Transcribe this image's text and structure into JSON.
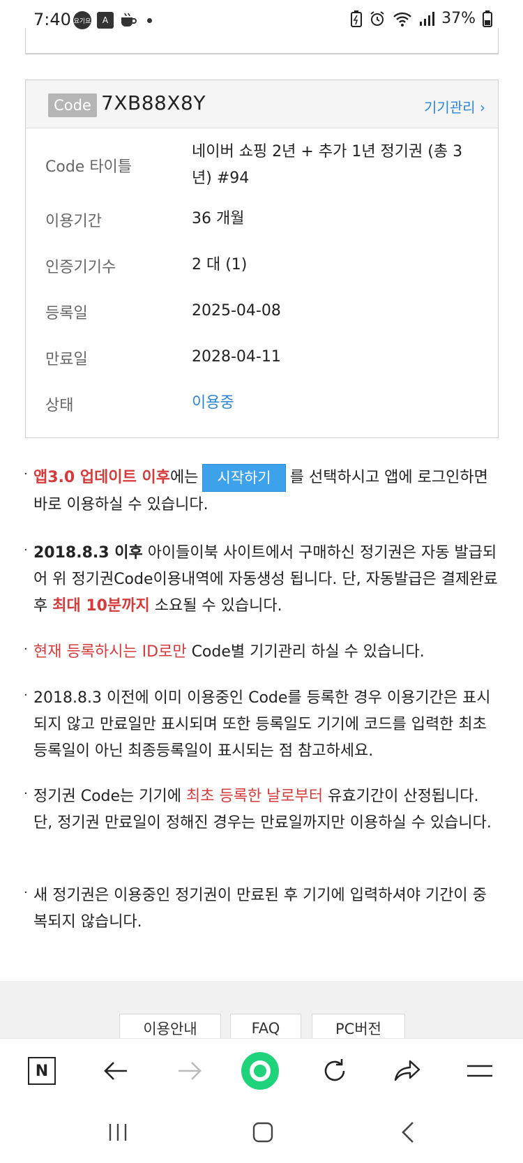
{
  "status_bar": {
    "time": "7:40",
    "badge_text": "요기요",
    "translate_icon_text": "A",
    "battery_percent": "37%"
  },
  "code_card": {
    "tag": "Code",
    "code": "7XB88X8Y",
    "device_link": "기기관리 ›",
    "rows": [
      {
        "label": "Code 타이틀",
        "value": "네이버 쇼핑 2년 + 추가 1년 정기권 (총 3년) #94"
      },
      {
        "label": "이용기간",
        "value": "36 개월"
      },
      {
        "label": "인증기기수",
        "value": "2 대 (1)"
      },
      {
        "label": "등록일",
        "value": "2025-04-08"
      },
      {
        "label": "만료일",
        "value": "2028-04-11"
      },
      {
        "label": "상태",
        "value": "이용중"
      }
    ],
    "status_color": "#2b86d6"
  },
  "notes": {
    "n1": {
      "bullet": "·",
      "red": "앱3.0 업데이트 이후",
      "mid": "에는",
      "button": "시작하기",
      "rest": "를 선택하시고 앱에 로그인하면 바로 이용하실 수 있습니다."
    },
    "n2": {
      "bullet": "·",
      "bold": "2018.8.3 이후",
      "mid": " 아이들이북 사이트에서 구매하신 정기권은 자동 발급되어 위 정기권Code이용내역에 자동생성 됩니다. 단, 자동발급은 결제완료후 ",
      "red": "최대 10분까지",
      "rest": " 소요될 수 있습니다."
    },
    "n3": {
      "bullet": "·",
      "red": "현재 등록하시는 ID로만",
      "rest": " Code별 기기관리 하실 수 있습니다."
    },
    "n4": {
      "bullet": "·",
      "text": "2018.8.3 이전에 이미 이용중인 Code를 등록한 경우 이용기간은 표시되지 않고 만료일만 표시되며 또한 등록일도 기기에 코드를 입력한 최초등록일이 아닌 최종등록일이 표시되는 점 참고하세요."
    },
    "n5": {
      "bullet": "·",
      "pre": "정기권 Code는 기기에 ",
      "red": "최초 등록한 날로부터",
      "rest": " 유효기간이 산정됩니다. 단, 정기권 만료일이 정해진 경우는 만료일까지만 이용하실 수 있습니다."
    },
    "n6": {
      "bullet": "·",
      "text": "새 정기권은 이용중인 정기권이 만료된 후 기기에 입력하셔야 기간이 중복되지 않습니다."
    }
  },
  "footer": {
    "buttons": [
      "이용안내",
      "FAQ",
      "PC버전"
    ]
  },
  "browser_bar": {
    "home_label": "N"
  }
}
